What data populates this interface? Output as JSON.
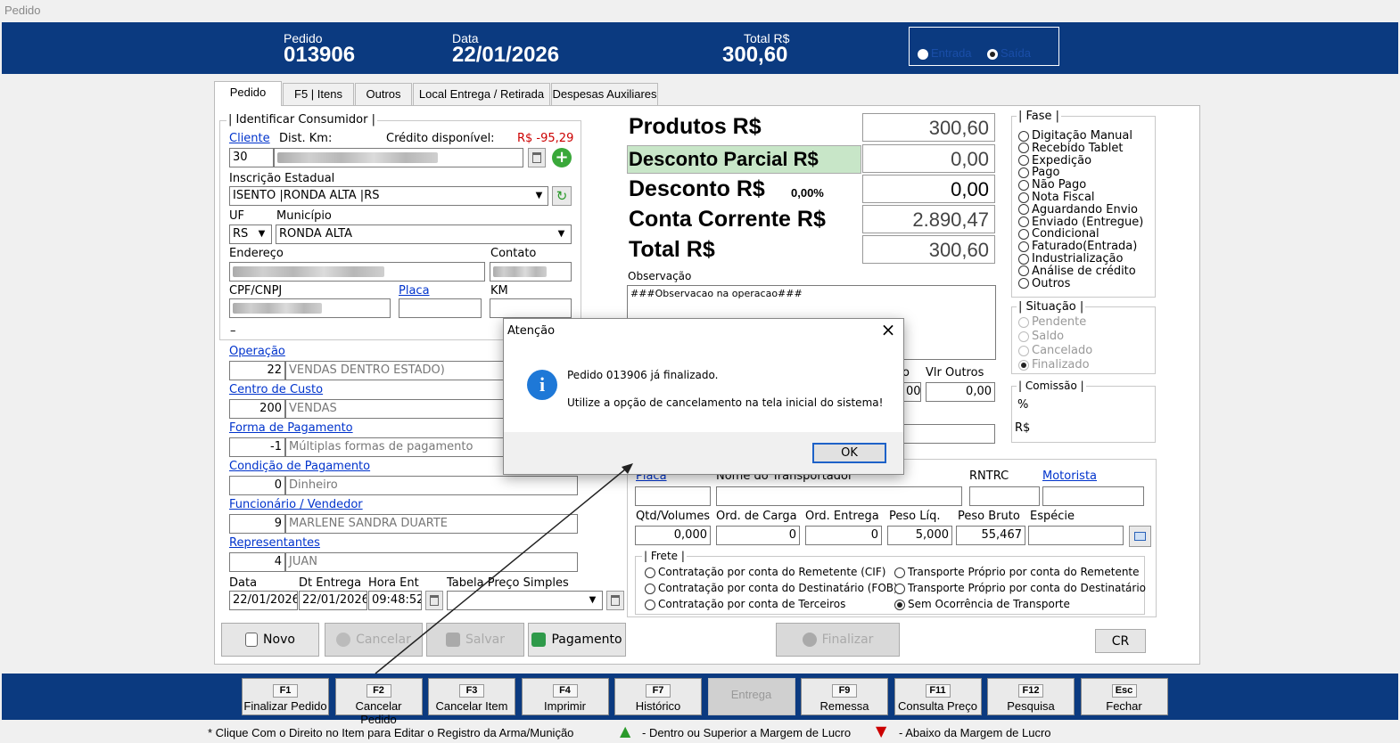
{
  "window_title": "Pedido",
  "header": {
    "pedido_label": "Pedido",
    "pedido_value": "013906",
    "data_label": "Data",
    "data_value": "22/01/2026",
    "total_label": "Total R$",
    "total_value": "300,60",
    "entrada_label": "Entrada",
    "saida_label": "Saída"
  },
  "tabs": [
    "Pedido",
    "F5 | Itens",
    "Outros",
    "Local Entrega  / Retirada",
    "Despesas Auxiliares"
  ],
  "consumidor": {
    "group_title": "| Identificar Consumidor |",
    "cliente_label": "Cliente",
    "dist_label": "Dist. Km:",
    "credito_label": "Crédito disponível:",
    "credito_value": "R$ -95,29",
    "cliente_code": "30",
    "ie_label": "Inscrição Estadual",
    "ie_value": "ISENTO  |RONDA ALTA  |RS",
    "uf_label": "UF",
    "uf_value": "RS",
    "municipio_label": "Município",
    "municipio_value": "RONDA ALTA",
    "endereco_label": "Endereço",
    "contato_label": "Contato",
    "cpf_label": "CPF/CNPJ",
    "placa_label": "Placa",
    "km_label": "KM",
    "dash": "–"
  },
  "operacao": {
    "label": "Operação",
    "code": "22",
    "desc": "VENDAS DENTRO ESTADO)"
  },
  "centro": {
    "label": "Centro de Custo",
    "code": "200",
    "desc": "VENDAS"
  },
  "forma": {
    "label": "Forma de Pagamento",
    "code": "-1",
    "desc": "Múltiplas formas de pagamento"
  },
  "condicao": {
    "label": "Condição de Pagamento",
    "code": "0",
    "desc": "Dinheiro"
  },
  "funcionario": {
    "label": "Funcionário / Vendedor",
    "code": "9",
    "desc": "MARLENE SANDRA DUARTE"
  },
  "representantes": {
    "label": "Representantes",
    "code": "4",
    "desc": "JUAN"
  },
  "datas": {
    "data_label": "Data",
    "data_value": "22/01/2026",
    "dt_entrega_label": "Dt Entrega",
    "dt_entrega_value": "22/01/2026",
    "hora_label": "Hora Ent",
    "hora_value": "09:48:52",
    "tabela_label": "Tabela Preço Simples"
  },
  "totais": {
    "produtos_label": "Produtos R$",
    "produtos_value": "300,60",
    "desc_parcial_label": "Desconto Parcial R$",
    "desc_parcial_value": "0,00",
    "desconto_label": "Desconto R$",
    "desconto_pct": "0,00%",
    "desconto_value": "0,00",
    "conta_label": "Conta Corrente R$",
    "conta_value": "2.890,47",
    "total_label": "Total R$",
    "total_value": "300,60"
  },
  "observacao": {
    "label": "Observação",
    "value": "###Observacao na operacao###"
  },
  "outros": {
    "vlr_outros_label": "Vlr Outros",
    "vlr_outros_value": "0,00",
    "partial_label": "o",
    "partial_value": "00"
  },
  "fase": {
    "title": "| Fase |",
    "items": [
      "Digitação Manual",
      "Recebido Tablet",
      "Expedição",
      "Pago",
      "Não Pago",
      "Nota Fiscal",
      "Aguardando Envio",
      "Enviado (Entregue)",
      "Condicional",
      "Faturado(Entrada)",
      "Industrialização",
      "Análise de crédito",
      "Outros"
    ]
  },
  "situacao": {
    "title": "| Situação |",
    "items": [
      "Pendente",
      "Saldo",
      "Cancelado",
      "Finalizado"
    ]
  },
  "comissao": {
    "title": "| Comissão |",
    "pct_label": "%",
    "rs_label": "R$"
  },
  "transporte": {
    "placa_label": "Placa",
    "nome_label": "Nome do Transportador",
    "rntrc_label": "RNTRC",
    "motorista_label": "Motorista",
    "qtd_label": "Qtd/Volumes",
    "qtd_value": "0,000",
    "ord_carga_label": "Ord. de Carga",
    "ord_carga_value": "0",
    "ord_entrega_label": "Ord. Entrega",
    "ord_entrega_value": "0",
    "peso_liq_label": "Peso Líq.",
    "peso_liq_value": "5,000",
    "peso_bruto_label": "Peso Bruto",
    "peso_bruto_value": "55,467",
    "especie_label": "Espécie"
  },
  "frete": {
    "title": "| Frete |",
    "left": [
      "Contratação por conta do Remetente (CIF)",
      "Contratação por conta do Destinatário (FOB)",
      "Contratação por conta de Terceiros"
    ],
    "right": [
      "Transporte Próprio por conta do Remetente",
      "Transporte Próprio por conta do Destinatário",
      "Sem Ocorrência de Transporte"
    ]
  },
  "actions": {
    "novo": "Novo",
    "cancelar": "Cancelar",
    "salvar": "Salvar",
    "pagamento": "Pagamento",
    "finalizar": "Finalizar",
    "cr": "CR"
  },
  "toolbar": [
    {
      "key": "F1",
      "label": "Finalizar Pedido"
    },
    {
      "key": "F2",
      "label": "Cancelar Pedido"
    },
    {
      "key": "F3",
      "label": "Cancelar Item"
    },
    {
      "key": "F4",
      "label": "Imprimir"
    },
    {
      "key": "F7",
      "label": "Histórico"
    },
    {
      "key": "",
      "label": "Entrega"
    },
    {
      "key": "F9",
      "label": "Remessa"
    },
    {
      "key": "F11",
      "label": "Consulta Preço"
    },
    {
      "key": "F12",
      "label": "Pesquisa"
    },
    {
      "key": "Esc",
      "label": "Fechar"
    }
  ],
  "footer": {
    "hint": "* Clique Com o Direito no Item para Editar o Registro da Arma/Munição",
    "above": "- Dentro ou Superior a Margem de Lucro",
    "below": "- Abaixo da Margem de Lucro"
  },
  "dialog": {
    "title": "Atenção",
    "line1": "Pedido 013906 já finalizado.",
    "line2": "Utilize a opção de cancelamento na tela inicial do sistema!",
    "ok": "OK"
  },
  "colors": {
    "header_blue": "#0b3a80",
    "desconto_parcial_bg": "#c8e6c8",
    "credito_red": "#cc0000",
    "info_blue": "#1e78d7"
  }
}
